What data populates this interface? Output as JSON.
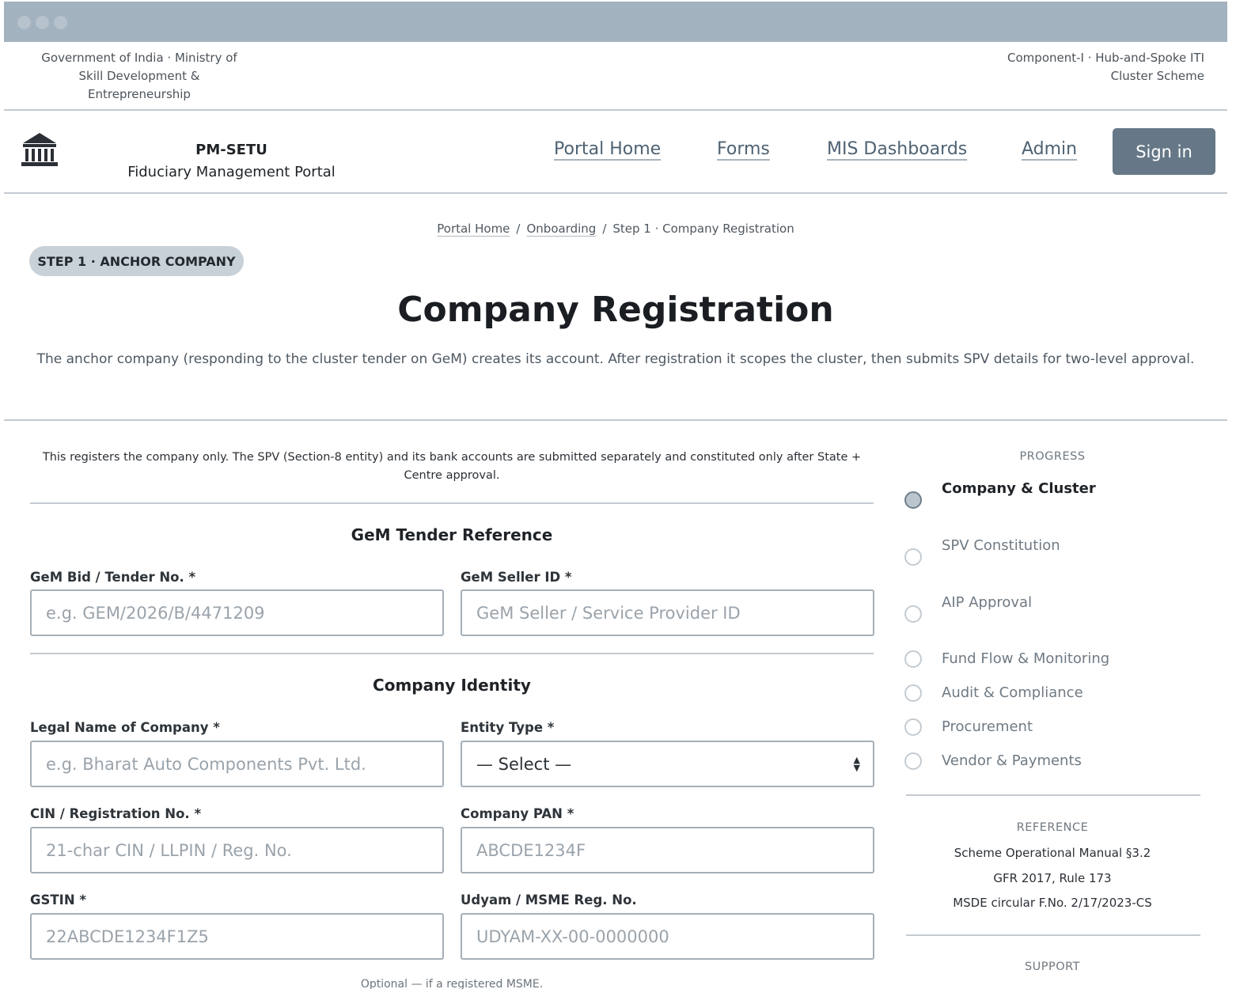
{
  "top_bar": {
    "left_text": "Government of India · Ministry of Skill Development & Entrepreneurship",
    "right_text": "Component-I · Hub-and-Spoke ITI Cluster Scheme"
  },
  "header": {
    "logo_icon": "institution-icon",
    "brand_title": "PM-SETU",
    "brand_subtitle": "Fiduciary Management Portal",
    "nav": {
      "home": "Portal Home",
      "forms": "Forms",
      "mis": "MIS Dashboards",
      "admin": "Admin"
    },
    "sign_in": "Sign in"
  },
  "breadcrumb": {
    "home": "Portal Home",
    "onboarding": "Onboarding",
    "current": "Step 1 · Company Registration",
    "separator": "/"
  },
  "step_badge": "STEP 1 · ANCHOR COMPANY",
  "page_title": "Company Registration",
  "page_description": "The anchor company (responding to the cluster tender on GeM) creates its account. After registration it scopes the cluster, then submits SPV details for two-level approval.",
  "form": {
    "note": "This registers the company only. The SPV (Section-8 entity) and its bank accounts are submitted separately and constituted only after State + Centre approval.",
    "gem_section": {
      "title": "GeM Tender Reference",
      "bid_label": "GeM Bid / Tender No. *",
      "bid_placeholder": "e.g. GEM/2026/B/4471209",
      "seller_label": "GeM Seller ID *",
      "seller_placeholder": "GeM Seller / Service Provider ID"
    },
    "identity_section": {
      "title": "Company Identity",
      "legal_name_label": "Legal Name of Company *",
      "legal_name_placeholder": "e.g. Bharat Auto Components Pvt. Ltd.",
      "entity_type_label": "Entity Type *",
      "entity_type_value": "— Select —",
      "cin_label": "CIN / Registration No. *",
      "cin_placeholder": "21-char CIN / LLPIN / Reg. No.",
      "pan_label": "Company PAN *",
      "pan_placeholder": "ABCDE1234F",
      "gstin_label": "GSTIN *",
      "gstin_placeholder": "22ABCDE1234F1Z5",
      "udyam_label": "Udyam / MSME Reg. No.",
      "udyam_placeholder": "UDYAM-XX-00-0000000",
      "udyam_hint": "Optional — if a registered MSME."
    }
  },
  "sidebar": {
    "progress_heading": "PROGRESS",
    "steps": [
      {
        "label": "Company & Cluster",
        "active": true
      },
      {
        "label": "SPV Constitution",
        "active": false
      },
      {
        "label": "AIP Approval",
        "active": false
      },
      {
        "label": "Fund Flow & Monitoring",
        "active": false
      },
      {
        "label": "Audit & Compliance",
        "active": false
      },
      {
        "label": "Procurement",
        "active": false
      },
      {
        "label": "Vendor & Payments",
        "active": false
      }
    ],
    "reference_heading": "REFERENCE",
    "references": [
      "Scheme Operational Manual §3.2",
      "GFR 2017, Rule 173",
      "MSDE circular F.No. 2/17/2023-CS"
    ],
    "support_heading": "SUPPORT"
  },
  "colors": {
    "accent": "#667887",
    "border": "#a5afb8",
    "chrome": "#a3b2bf",
    "pill": "#c9d1d8"
  }
}
